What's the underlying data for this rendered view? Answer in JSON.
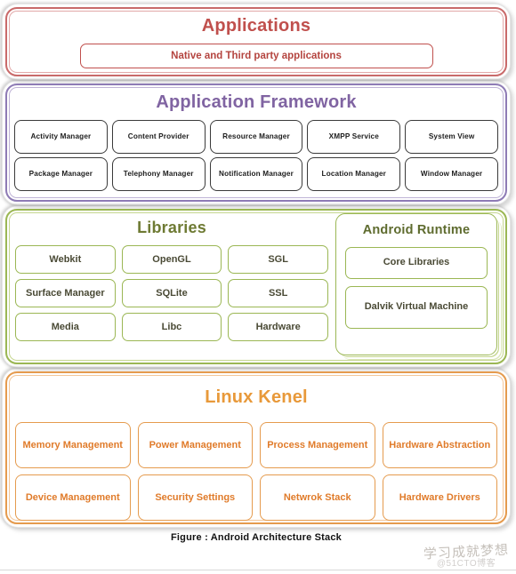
{
  "figure": {
    "caption": "Figure : Android Architecture Stack",
    "watermark_cn": "学习成就梦想",
    "watermark_sub": "@51CTO博客"
  },
  "colors": {
    "applications": "#C0504D",
    "framework": "#8064A2",
    "libraries": "#9BB754",
    "libraries_title": "#6E7A33",
    "kernel": "#E8993A",
    "framework_cell_border": "#3A3A3A"
  },
  "layers": {
    "applications": {
      "title": "Applications",
      "items": [
        "Native and Third party applications"
      ]
    },
    "framework": {
      "title": "Application Framework",
      "items": [
        "Activity Manager",
        "Content Provider",
        "Resource Manager",
        "XMPP Service",
        "System View",
        "Package Manager",
        "Telephony  Manager",
        "Notification Manager",
        "Location Manager",
        "Window  Manager"
      ]
    },
    "libraries": {
      "title": "Libraries",
      "items": [
        "Webkit",
        "OpenGL",
        "SGL",
        "Surface Manager",
        "SQLite",
        "SSL",
        "Media",
        "Libc",
        "Hardware"
      ]
    },
    "runtime": {
      "title": "Android Runtime",
      "items": [
        "Core Libraries",
        "Dalvik Virtual Machine"
      ]
    },
    "kernel": {
      "title": "Linux Kenel",
      "items": [
        "Memory Management",
        "Power Management",
        "Process Management",
        "Hardware Abstraction",
        "Device Management",
        "Security Settings",
        "Netwrok Stack",
        "Hardware Drivers"
      ]
    }
  }
}
